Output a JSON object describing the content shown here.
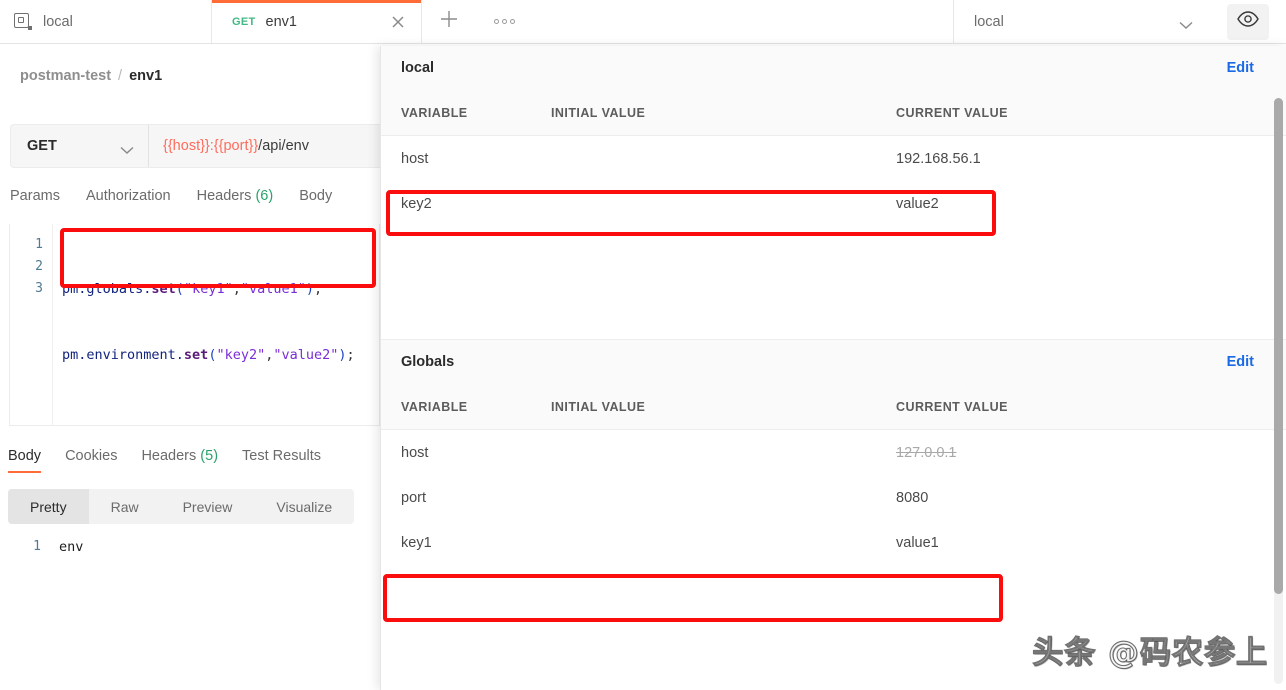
{
  "tabbar": {
    "environment_chip": {
      "icon": "layers-icon",
      "label": "local"
    },
    "request_tab": {
      "method": "GET",
      "name": "env1",
      "close_icon": "close-icon"
    },
    "new_tab_icon": "plus-icon",
    "more_tabs_icon": "ellipsis-icon",
    "env_selector": {
      "value": "local",
      "chevron_icon": "chevron-down-icon"
    },
    "eye_icon": "eye-icon"
  },
  "breadcrumb": {
    "collection": "postman-test",
    "separator": "/",
    "request": "env1"
  },
  "request": {
    "method": "GET",
    "method_chevron_icon": "chevron-down-icon",
    "url_variables": "{{host}}:{{port}}",
    "url_path": "/api/env",
    "tabs": [
      {
        "label": "Params",
        "count": ""
      },
      {
        "label": "Authorization",
        "count": ""
      },
      {
        "label": "Headers",
        "count": "(6)"
      },
      {
        "label": "Body",
        "count": ""
      }
    ]
  },
  "script_editor": {
    "lines": [
      {
        "num": "1",
        "object": "pm.globals.",
        "fn": "set",
        "open": "(",
        "arg1": "\"key1\"",
        "comma": ",",
        "arg2": "\"value1\"",
        "close": ")",
        "semi": ";"
      },
      {
        "num": "2",
        "object": "pm.environment.",
        "fn": "set",
        "open": "(",
        "arg1": "\"key2\"",
        "comma": ",",
        "arg2": "\"value2\"",
        "close": ")",
        "semi": ";"
      },
      {
        "num": "3",
        "object": "",
        "fn": "",
        "open": "",
        "arg1": "",
        "comma": "",
        "arg2": "",
        "close": "",
        "semi": ""
      }
    ]
  },
  "response": {
    "tabs": [
      {
        "label": "Body",
        "count": ""
      },
      {
        "label": "Cookies",
        "count": ""
      },
      {
        "label": "Headers",
        "count": "(5)"
      },
      {
        "label": "Test Results",
        "count": ""
      }
    ],
    "view_modes": [
      "Pretty",
      "Raw",
      "Preview",
      "Visualize"
    ],
    "selected_view_mode": "Pretty",
    "body_line_number": "1",
    "body_text": "env"
  },
  "env_panel": {
    "columns": {
      "variable": "VARIABLE",
      "initial": "INITIAL VALUE",
      "current": "CURRENT VALUE"
    },
    "sections": [
      {
        "title": "local",
        "edit_label": "Edit",
        "rows": [
          {
            "variable": "host",
            "initial": "",
            "current": "192.168.56.1",
            "struck": false
          },
          {
            "variable": "key2",
            "initial": "",
            "current": "value2",
            "struck": false
          }
        ]
      },
      {
        "title": "Globals",
        "edit_label": "Edit",
        "rows": [
          {
            "variable": "host",
            "initial": "",
            "current": "127.0.0.1",
            "struck": true
          },
          {
            "variable": "port",
            "initial": "",
            "current": "8080",
            "struck": false
          },
          {
            "variable": "key1",
            "initial": "",
            "current": "value1",
            "struck": false
          }
        ]
      }
    ]
  },
  "annotations": {
    "color": "#fb0d0d",
    "boxes": [
      "script-lines-highlight",
      "key2-row-highlight",
      "key1-row-highlight"
    ]
  },
  "watermark": {
    "text": "头条 @码农参上"
  }
}
